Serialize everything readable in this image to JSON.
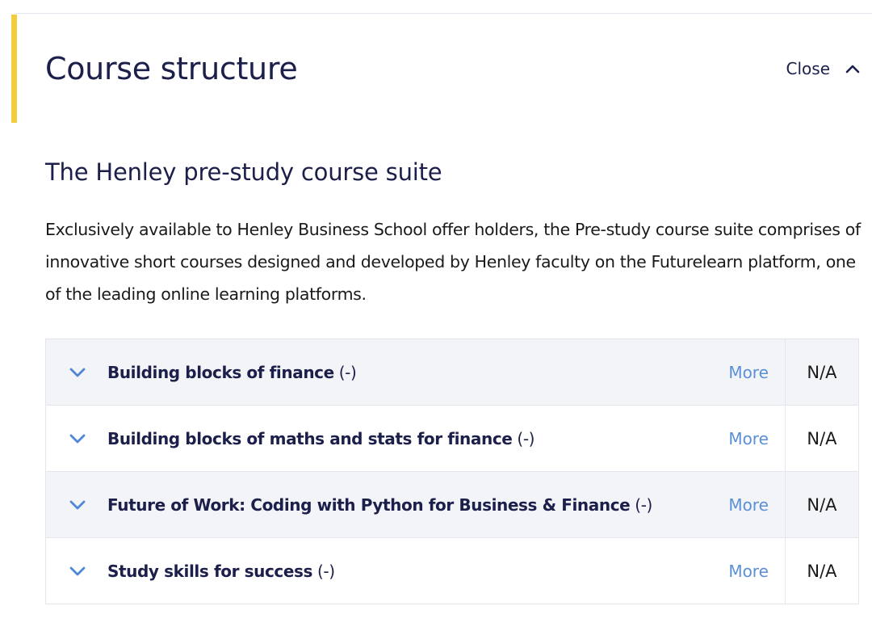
{
  "section": {
    "title": "Course structure",
    "toggle_label": "Close",
    "accent_color": "#f5cc3d"
  },
  "subtitle": "The Henley pre-study course suite",
  "intro": "Exclusively available to Henley Business School offer holders, the Pre-study course suite comprises of innovative short courses designed and developed by Henley faculty on the Futurelearn platform, one of the leading online learning platforms.",
  "courses": [
    {
      "name": "Building blocks of finance",
      "code": "(-)",
      "more_label": "More",
      "value": "N/A"
    },
    {
      "name": "Building blocks of maths and stats for finance",
      "code": "(-)",
      "more_label": "More",
      "value": "N/A"
    },
    {
      "name": "Future of Work: Coding with Python for Business & Finance",
      "code": "(-)",
      "more_label": "More",
      "value": "N/A"
    },
    {
      "name": "Study skills for success",
      "code": "(-)",
      "more_label": "More",
      "value": "N/A"
    }
  ],
  "icons": {
    "toggle": "chevron-up-icon",
    "row_expand": "chevron-down-icon"
  },
  "colors": {
    "heading": "#1b1f4a",
    "link": "#5b8fd6",
    "row_shaded": "#f3f4f8",
    "border": "#e3e6ec"
  }
}
